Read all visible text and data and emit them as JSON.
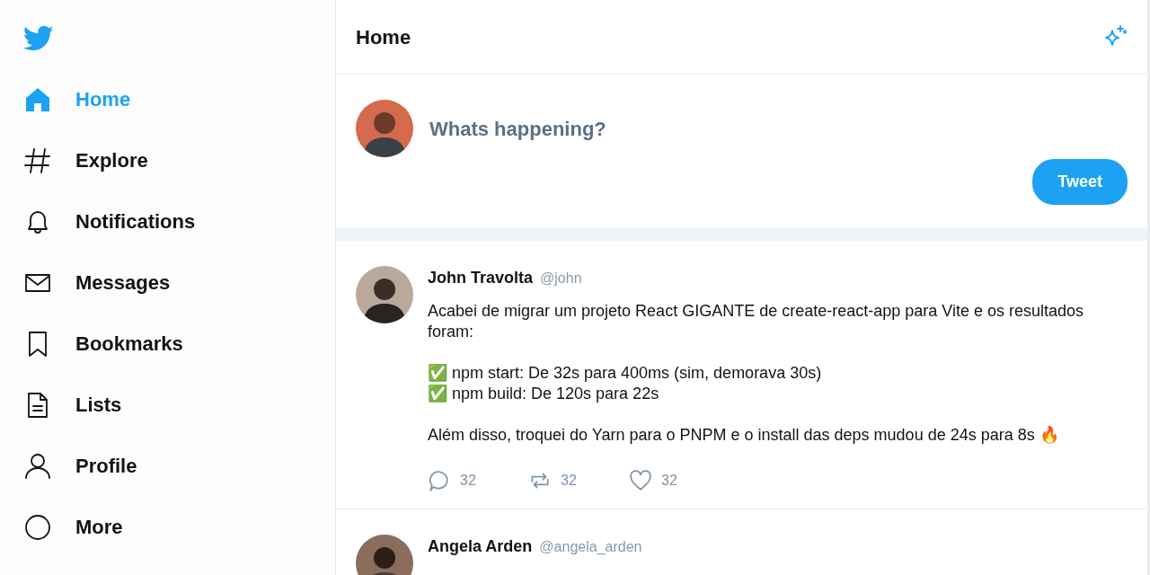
{
  "sidebar": {
    "items": [
      {
        "kind": "home",
        "label": "Home",
        "selected": true
      },
      {
        "kind": "explore",
        "label": "Explore",
        "selected": false
      },
      {
        "kind": "notifications",
        "label": "Notifications",
        "selected": false
      },
      {
        "kind": "messages",
        "label": "Messages",
        "selected": false
      },
      {
        "kind": "bookmarks",
        "label": "Bookmarks",
        "selected": false
      },
      {
        "kind": "lists",
        "label": "Lists",
        "selected": false
      },
      {
        "kind": "profile",
        "label": "Profile",
        "selected": false
      },
      {
        "kind": "more",
        "label": "More",
        "selected": false
      }
    ]
  },
  "header": {
    "title": "Home"
  },
  "composer": {
    "placeholder": "Whats happening?",
    "button": "Tweet"
  },
  "tweets": [
    {
      "name": "John Travolta",
      "handle": "@john",
      "text": "Acabei de migrar um projeto React GIGANTE de create-react-app para Vite e os resultados foram:\n\n✅ npm start: De 32s para 400ms (sim, demorava 30s)\n✅ npm build: De 120s para 22s\n\nAlém disso, troquei do Yarn para o PNPM e o install das deps mudou de 24s para 8s 🔥",
      "actions": [
        {
          "kind": "reply",
          "count": "32"
        },
        {
          "kind": "retweet",
          "count": "32"
        },
        {
          "kind": "like",
          "count": "32"
        }
      ]
    },
    {
      "name": "Angela Arden",
      "handle": "@angela_arden"
    }
  ]
}
